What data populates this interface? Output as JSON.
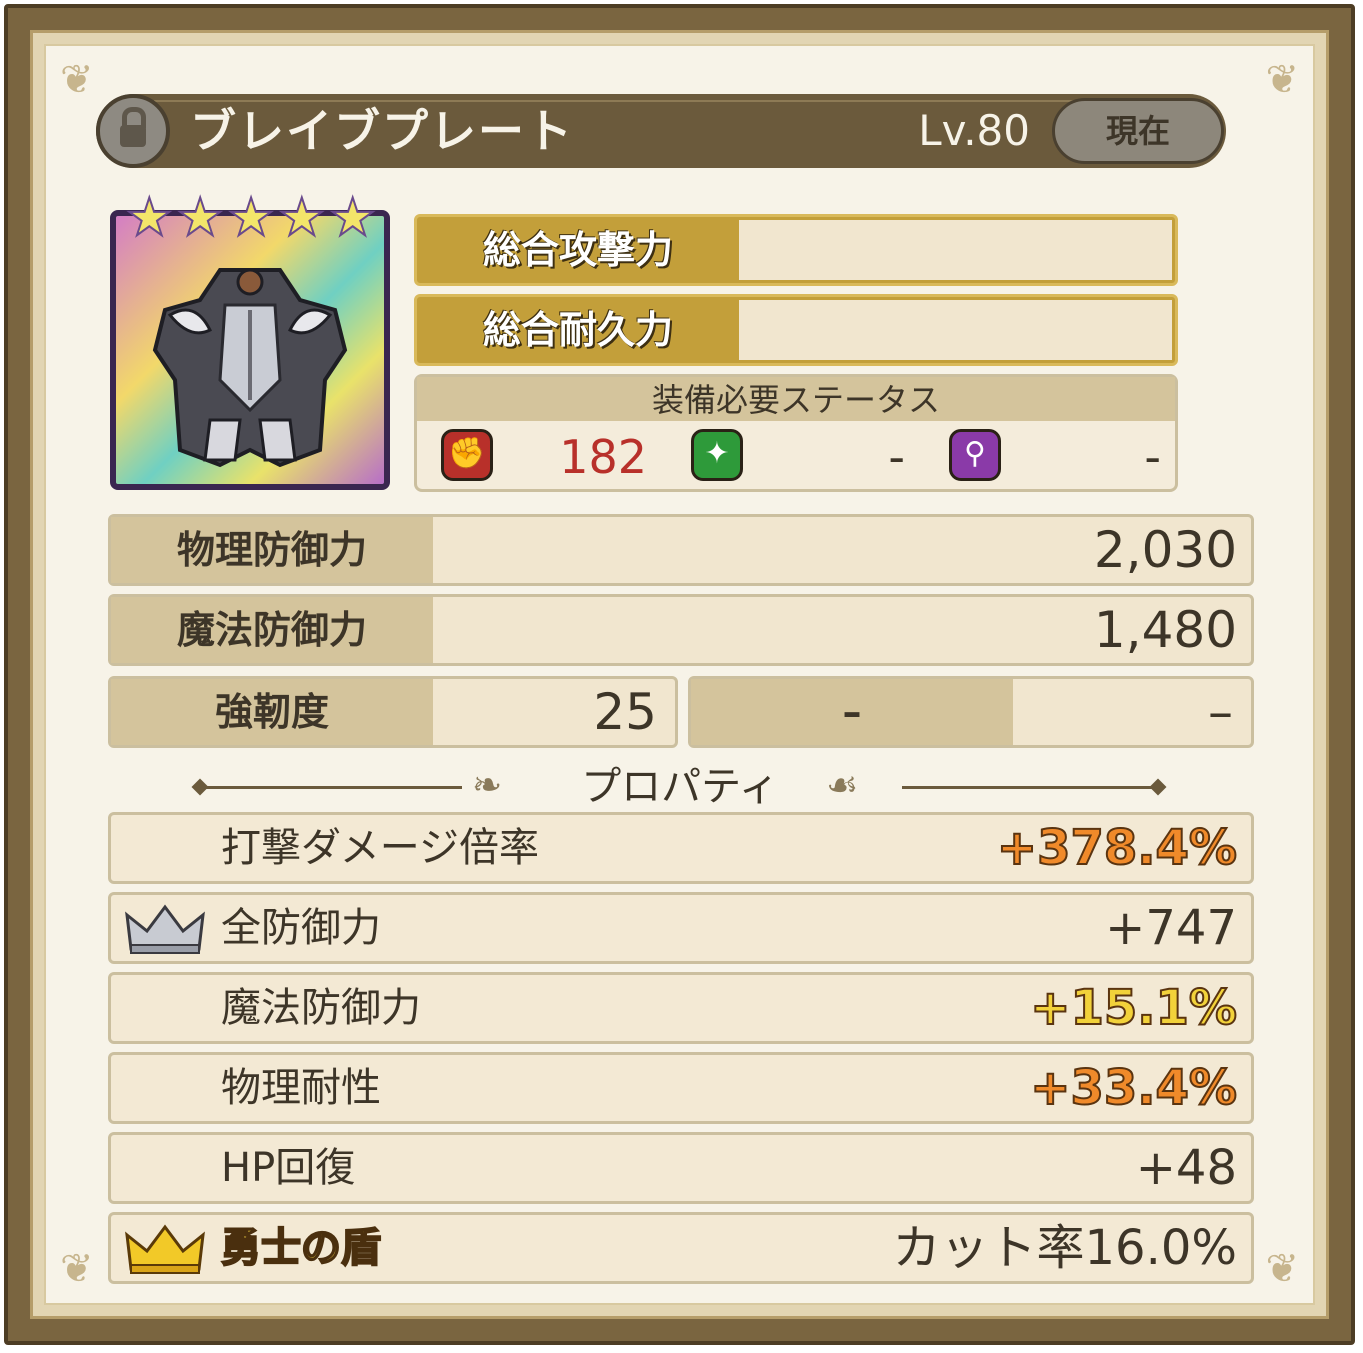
{
  "item": {
    "name": "ブレイブプレート",
    "level": "Lv.80",
    "current_label": "現在",
    "rarity_stars": 5
  },
  "totals": {
    "attack_label": "総合攻撃力",
    "attack_value": "",
    "durability_label": "総合耐久力",
    "durability_value": ""
  },
  "requirements": {
    "title": "装備必要ステータス",
    "strength": "182",
    "dexterity": "-",
    "magic": "-",
    "colors": {
      "strength": "#b8302a",
      "dexterity": "#2e9a3a",
      "magic": "#8a3aa8"
    }
  },
  "defense": {
    "physical_label": "物理防御力",
    "physical_value": "2,030",
    "magic_label": "魔法防御力",
    "magic_value": "1,480",
    "toughness_label": "強靭度",
    "toughness_value": "25",
    "extra_label": "–",
    "extra_value": "–"
  },
  "properties": {
    "header": "プロパティ",
    "rows": [
      {
        "label": "打撃ダメージ倍率",
        "value": "+378.4%",
        "style": "orange",
        "crown": ""
      },
      {
        "label": "全防御力",
        "value": "+747",
        "style": "plain",
        "crown": "silver"
      },
      {
        "label": "魔法防御力",
        "value": "+15.1%",
        "style": "yellow",
        "crown": ""
      },
      {
        "label": "物理耐性",
        "value": "+33.4%",
        "style": "orange",
        "crown": ""
      },
      {
        "label": "HP回復",
        "value": "+48",
        "style": "plain",
        "crown": ""
      },
      {
        "label": "勇士の盾",
        "value": "カット率16.0%",
        "style": "plain",
        "crown": "gold"
      }
    ]
  },
  "icons": {
    "lock": "lock-icon",
    "strength": "fist-icon",
    "dexterity": "sparkle-icon",
    "magic": "wand-icon",
    "silver_crown": "silver-crown-icon",
    "gold_crown": "gold-crown-icon"
  }
}
